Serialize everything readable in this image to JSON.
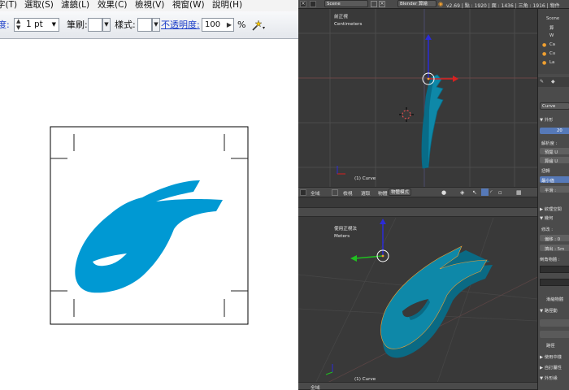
{
  "illustrator": {
    "menu": [
      "字(T)",
      "選取(S)",
      "濾鏡(L)",
      "效果(C)",
      "檢視(V)",
      "視窗(W)",
      "說明(H)"
    ],
    "control_bar": {
      "stroke_partial_label": "度:",
      "stroke_weight": "1 pt",
      "brush_label": "筆刷:",
      "style_label": "樣式:",
      "opacity_label": "不透明度:",
      "opacity_value": "100",
      "opacity_unit": "%"
    },
    "logo_color": "#0099d3"
  },
  "blender": {
    "info_header": {
      "scene": "Scene",
      "engine": "Blender 算繪",
      "stats": "v2.69 | 點 : 1920 | 面 : 1436 | 三角 : 1916 | 物件"
    },
    "top_viewport": {
      "view_name": "前正視",
      "units": "Centimeters",
      "object_label": "(1) Curve"
    },
    "bottom_viewport": {
      "view_name": "使用正視法",
      "units": "Meters",
      "object_label": "(1) Curve"
    },
    "header_menu": [
      "全域",
      "檢視",
      "選取",
      "物體",
      "物體模式"
    ],
    "bottom_header_menu": [
      "全域"
    ],
    "outliner": [
      "Scene",
      "算",
      "W",
      "Ca",
      "Cu",
      "La"
    ],
    "properties": {
      "curve_name": "Curve",
      "shape_section": "▼ 外形",
      "resolution_value": "20",
      "resolution_label": "解析度 :",
      "preview_label": "預覽 U",
      "render_label": "算繪 U",
      "twist_label": "扭轉",
      "min_label": "最小值",
      "smooth_label": "平滑 :",
      "texture_section": "▶ 紋理空間",
      "geometry_section": "▼ 幾何",
      "modify_label": "修改 :",
      "offset_label": "偏移 : 0",
      "extrude_label": "擠出 : 5m",
      "bevel_label": "倒角物體 :",
      "taper_label": "漸縮物體",
      "path_section": "▼ 路徑動",
      "path_label": "路徑",
      "use_pathobj": "▶ 使用中樣",
      "custom_attr": "▶ 自訂屬性",
      "outer_shape": "▼ 外形緣"
    },
    "theme": {
      "object_color": "#0e88a8",
      "object_dark": "#0a6a84",
      "outline": "#f0a030",
      "x_axis": "#e02020",
      "y_axis": "#20c020",
      "z_axis": "#2020e0"
    }
  }
}
